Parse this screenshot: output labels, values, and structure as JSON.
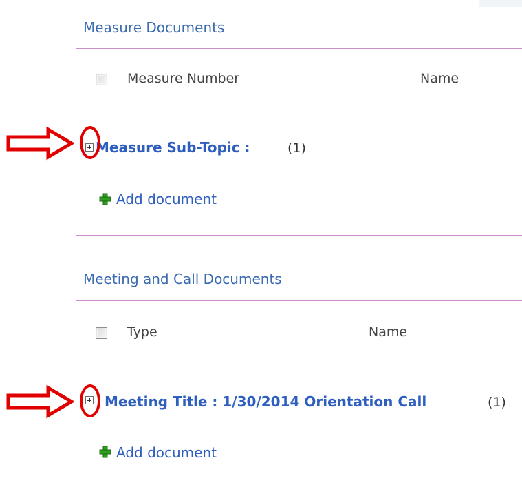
{
  "measure_documents": {
    "title": "Measure Documents",
    "columns": [
      "Measure Number",
      "Name"
    ],
    "group": {
      "label": "Measure Sub-Topic",
      "separator": ":",
      "value": "",
      "count": "(1)"
    },
    "add_label": "Add document"
  },
  "meeting_documents": {
    "title": "Meeting and Call Documents",
    "columns": [
      "Type",
      "Name"
    ],
    "group": {
      "label": "Meeting Title",
      "separator": ":",
      "value": "1/30/2014 Orientation Call",
      "count": "(1)"
    },
    "add_label": "Add document"
  },
  "colors": {
    "link": "#2f5fbe",
    "title": "#3b6bb0",
    "panel_border": "#c88fc8",
    "annotation": "#e00000",
    "add_icon": "#2e9e1e"
  },
  "icons": {
    "expand": "plus-box-icon",
    "add": "green-plus-icon",
    "annotation_arrow": "red-arrow",
    "annotation_circle": "red-circle"
  }
}
